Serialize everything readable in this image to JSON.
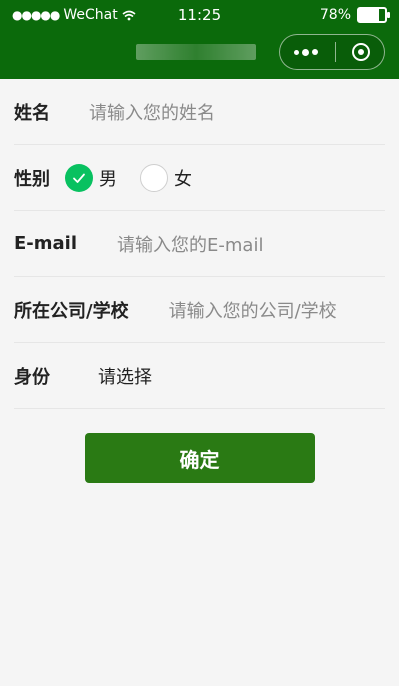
{
  "status_bar": {
    "carrier": "WeChat",
    "time": "11:25",
    "battery": "78%",
    "battery_level": 0.78
  },
  "capsule": {
    "more_icon": "more-dots-icon",
    "close_icon": "target-icon"
  },
  "form": {
    "name": {
      "label": "姓名",
      "placeholder": "请输入您的姓名"
    },
    "gender": {
      "label": "性别",
      "options": [
        {
          "label": "男",
          "checked": true
        },
        {
          "label": "女",
          "checked": false
        }
      ]
    },
    "email": {
      "label": "E-mail",
      "placeholder": "请输入您的E-mail"
    },
    "company": {
      "label": "所在公司/学校",
      "placeholder": "请输入您的公司/学校"
    },
    "identity": {
      "label": "身份",
      "value": "请选择"
    }
  },
  "confirm_label": "确定",
  "colors": {
    "header": "#0b6a0b",
    "check": "#08c160",
    "button": "#2a7a14"
  }
}
